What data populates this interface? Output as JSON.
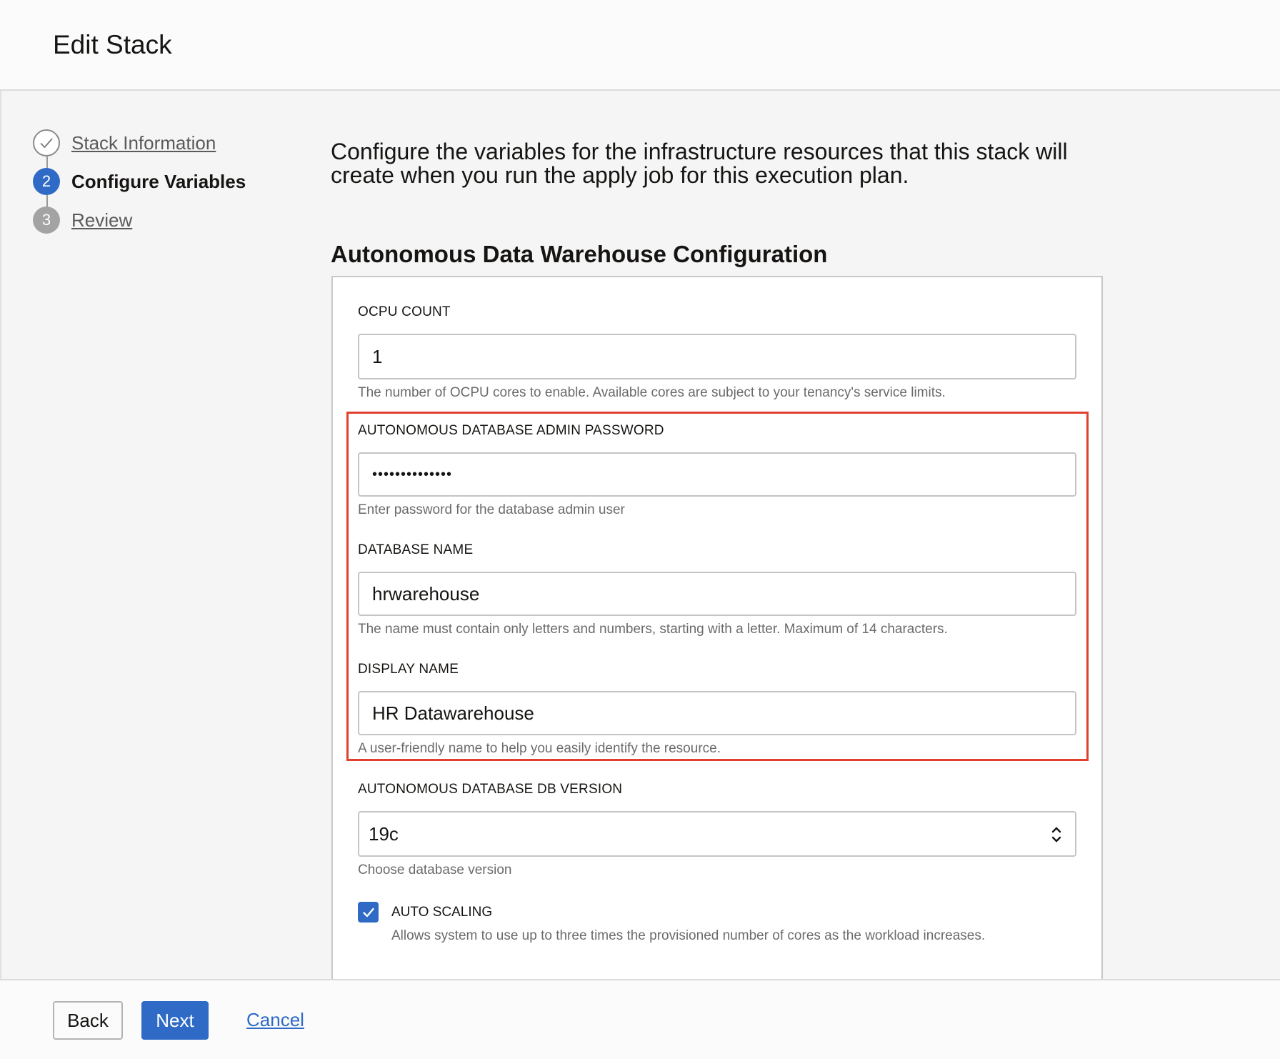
{
  "header": {
    "title": "Edit Stack"
  },
  "steps": [
    {
      "number": "",
      "label": "Stack Information",
      "state": "done"
    },
    {
      "number": "2",
      "label": "Configure Variables",
      "state": "active"
    },
    {
      "number": "3",
      "label": "Review",
      "state": "pending"
    }
  ],
  "intro": "Configure the variables for the infrastructure resources that this stack will create when you run the apply job for this execution plan.",
  "section_title": "Autonomous Data Warehouse Configuration",
  "fields": {
    "ocpu": {
      "label": "OCPU COUNT",
      "value": "1",
      "help": "The number of OCPU cores to enable. Available cores are subject to your tenancy's service limits."
    },
    "password": {
      "label": "AUTONOMOUS DATABASE ADMIN PASSWORD",
      "value": "••••••••••••••",
      "help": "Enter password for the database admin user"
    },
    "db_name": {
      "label": "DATABASE NAME",
      "value": "hrwarehouse",
      "help": "The name must contain only letters and numbers, starting with a letter. Maximum of 14 characters."
    },
    "display_name": {
      "label": "DISPLAY NAME",
      "value": "HR Datawarehouse",
      "help": "A user-friendly name to help you easily identify the resource."
    },
    "db_version": {
      "label": "AUTONOMOUS DATABASE DB VERSION",
      "value": "19c",
      "help": "Choose database version"
    }
  },
  "auto_scaling": {
    "label": "AUTO SCALING",
    "help": "Allows system to use up to three times the provisioned number of cores as the workload increases.",
    "checked": true
  },
  "footer": {
    "back_label": "Back",
    "next_label": "Next",
    "cancel_label": "Cancel"
  },
  "colors": {
    "accent": "#2f6bc6",
    "highlight": "#e0412f"
  }
}
